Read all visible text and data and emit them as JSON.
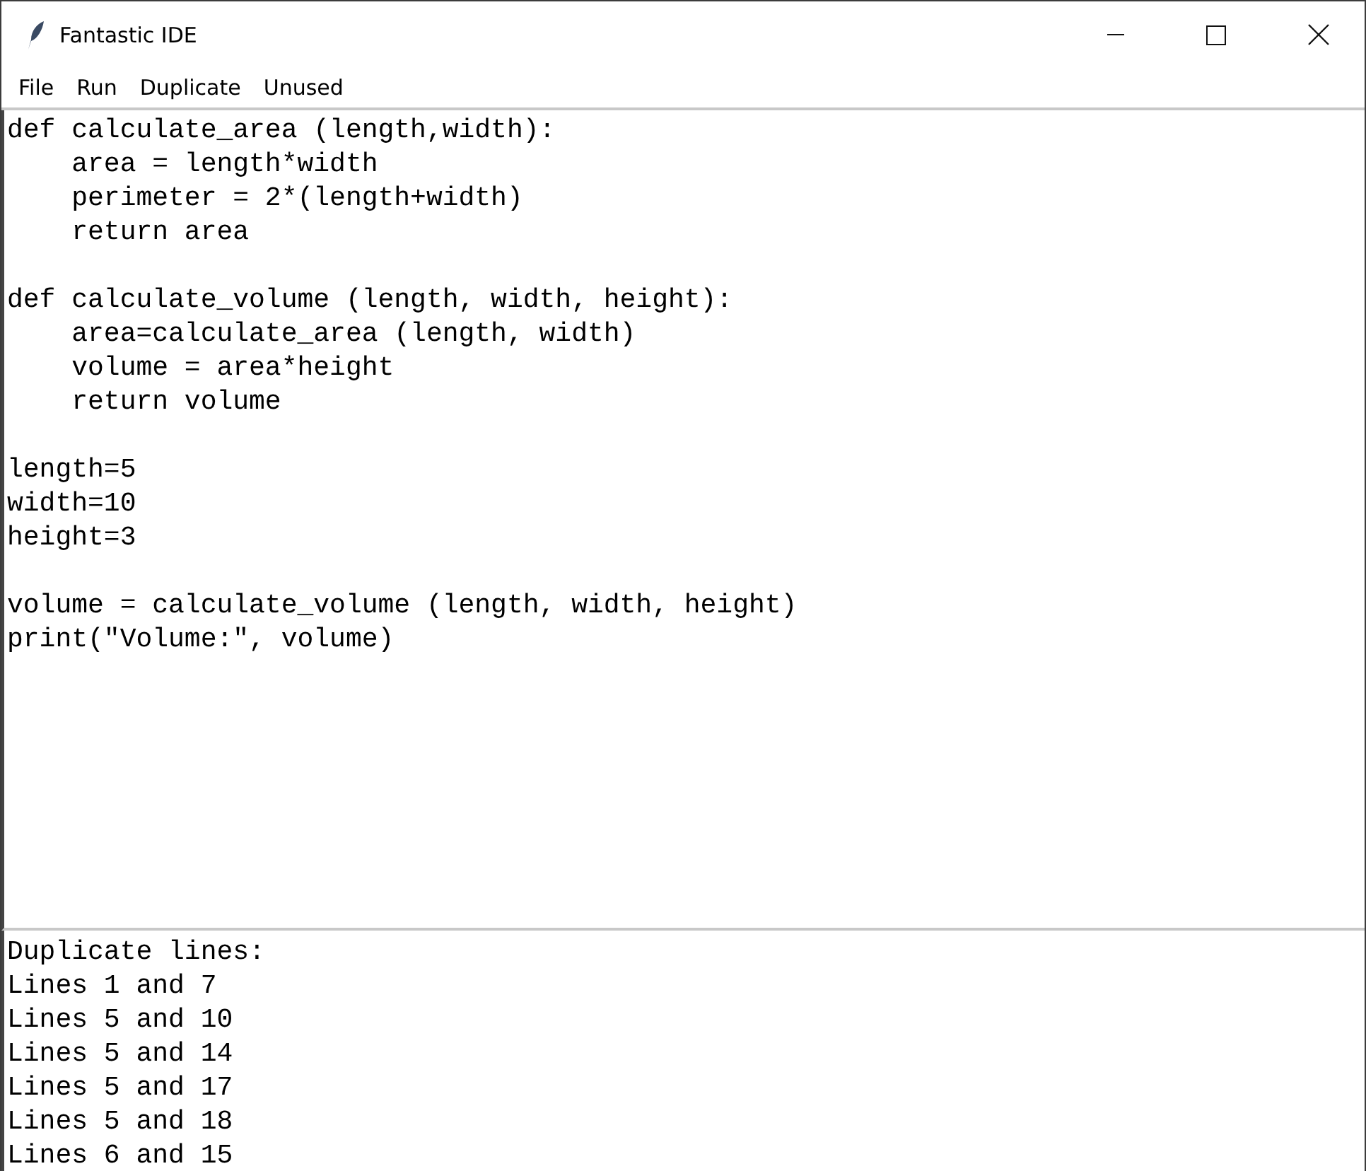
{
  "window": {
    "title": "Fantastic IDE"
  },
  "menu": [
    "File",
    "Run",
    "Duplicate",
    "Unused"
  ],
  "editor": {
    "code": "def calculate_area (length,width):\n    area = length*width\n    perimeter = 2*(length+width)\n    return area\n\ndef calculate_volume (length, width, height):\n    area=calculate_area (length, width)\n    volume = area*height\n    return volume\n\nlength=5\nwidth=10\nheight=3\n\nvolume = calculate_volume (length, width, height)\nprint(\"Volume:\", volume)"
  },
  "output": {
    "lines": [
      "Duplicate lines:",
      "Lines 1 and 7",
      "Lines 5 and 10",
      "Lines 5 and 14",
      "Lines 5 and 17",
      "Lines 5 and 18",
      "Lines 6 and 15"
    ]
  }
}
